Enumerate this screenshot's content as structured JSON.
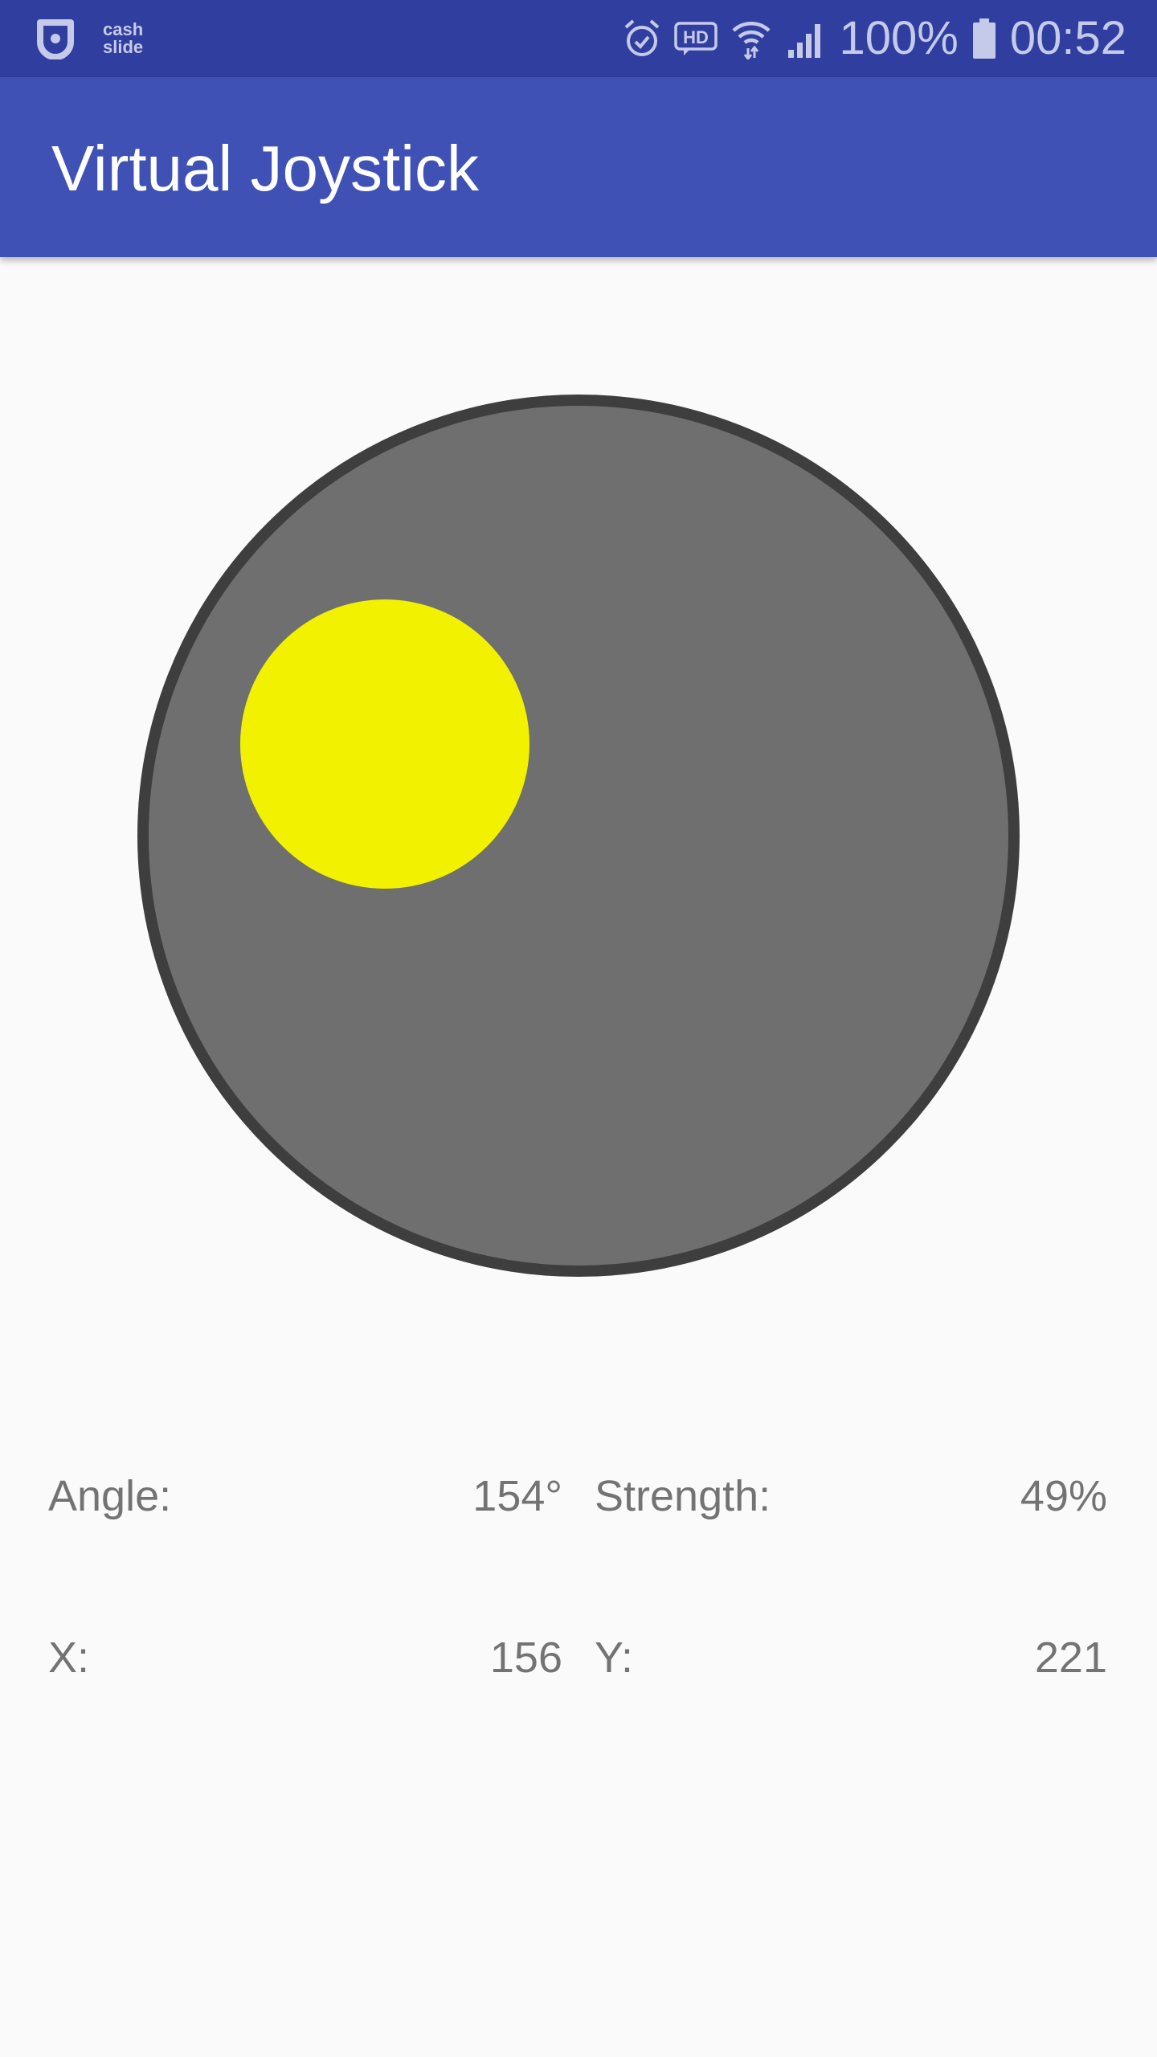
{
  "status_bar": {
    "notification_app": "cash\nslide",
    "battery_percent": "100%",
    "time": "00:52",
    "icons": [
      "cashslide-icon",
      "alarm-icon",
      "hd-icon",
      "wifi-icon",
      "signal-icon",
      "battery-icon"
    ]
  },
  "app_bar": {
    "title": "Virtual Joystick"
  },
  "joystick": {
    "base_color": "#6f6f6f",
    "border_color": "#3e3e3e",
    "knob_color": "#f2f200"
  },
  "readouts": {
    "angle_label": "Angle:",
    "angle_value": "154°",
    "strength_label": "Strength:",
    "strength_value": "49%",
    "x_label": "X:",
    "x_value": "156",
    "y_label": "Y:",
    "y_value": "221"
  }
}
